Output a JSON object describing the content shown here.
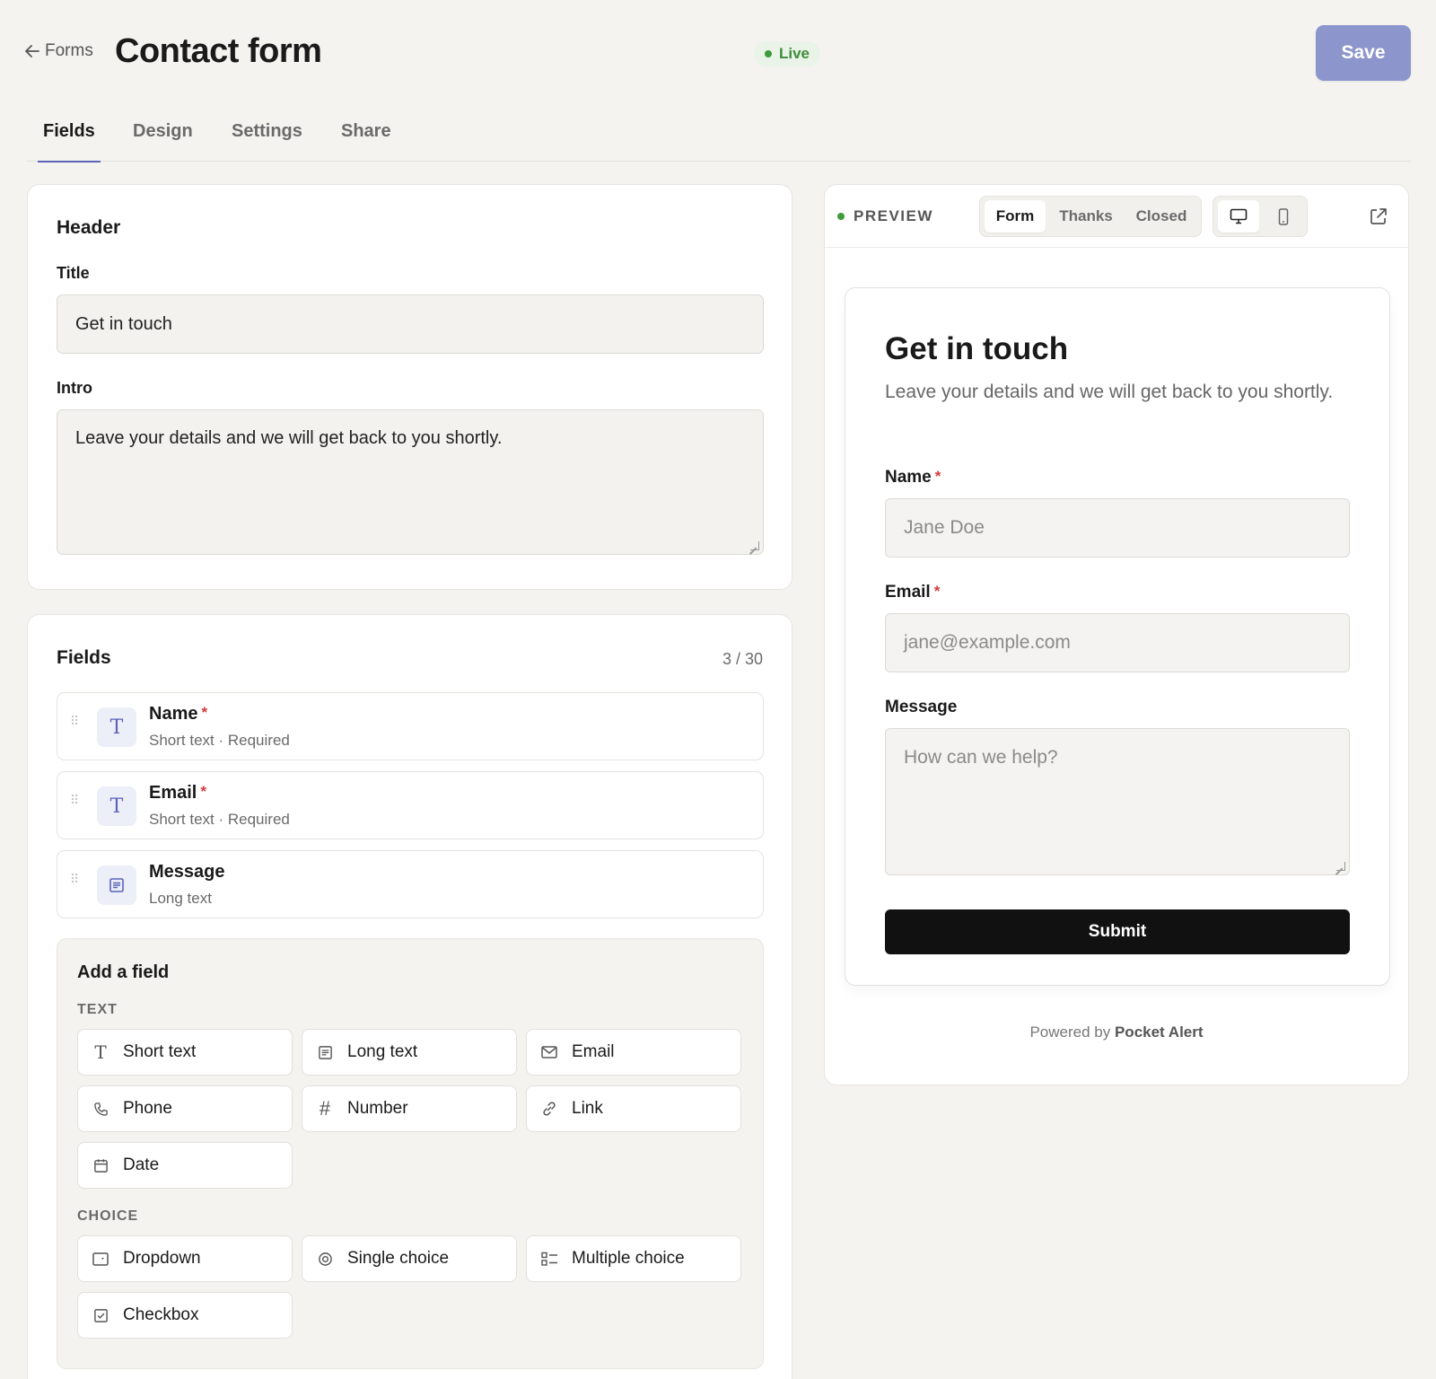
{
  "header": {
    "back_label": "Forms",
    "title": "Contact form",
    "status": "Live",
    "save_label": "Save"
  },
  "tabs": [
    {
      "label": "Fields",
      "active": true
    },
    {
      "label": "Design",
      "active": false
    },
    {
      "label": "Settings",
      "active": false
    },
    {
      "label": "Share",
      "active": false
    }
  ],
  "header_card": {
    "heading": "Header",
    "title_label": "Title",
    "title_value": "Get in touch",
    "intro_label": "Intro",
    "intro_value": "Leave your details and we will get back to you shortly."
  },
  "fields_card": {
    "heading": "Fields",
    "count": "3 / 30",
    "fields": [
      {
        "name": "Name",
        "required_mark": "*",
        "meta": "Short text · Required",
        "icon": "text-type-icon"
      },
      {
        "name": "Email",
        "required_mark": "*",
        "meta": "Short text · Required",
        "icon": "text-type-icon"
      },
      {
        "name": "Message",
        "required_mark": "",
        "meta": "Long text",
        "icon": "long-text-icon"
      }
    ],
    "add": {
      "heading": "Add a field",
      "text_section": "TEXT",
      "text_types": [
        "Short text",
        "Long text",
        "Email",
        "Phone",
        "Number",
        "Link",
        "Date"
      ],
      "choice_section": "CHOICE",
      "choice_types": [
        "Dropdown",
        "Single choice",
        "Multiple choice",
        "Checkbox"
      ]
    }
  },
  "preview": {
    "label": "PREVIEW",
    "segments": [
      "Form",
      "Thanks",
      "Closed"
    ],
    "active_segment": "Form",
    "devices": [
      "desktop-icon",
      "mobile-icon"
    ],
    "form": {
      "title": "Get in touch",
      "intro": "Leave your details and we will get back to you shortly.",
      "name_label": "Name",
      "name_placeholder": "Jane Doe",
      "email_label": "Email",
      "email_placeholder": "jane@example.com",
      "message_label": "Message",
      "message_placeholder": "How can we help?",
      "required_mark": "*",
      "submit_label": "Submit"
    },
    "powered_prefix": "Powered by",
    "powered_brand": "Pocket Alert"
  },
  "colors": {
    "accent": "#5a63b8",
    "save_button": "#8d96cc",
    "live_green": "#3e9b3b",
    "required_red": "#d23b3b",
    "page_bg": "#f4f3f0"
  }
}
